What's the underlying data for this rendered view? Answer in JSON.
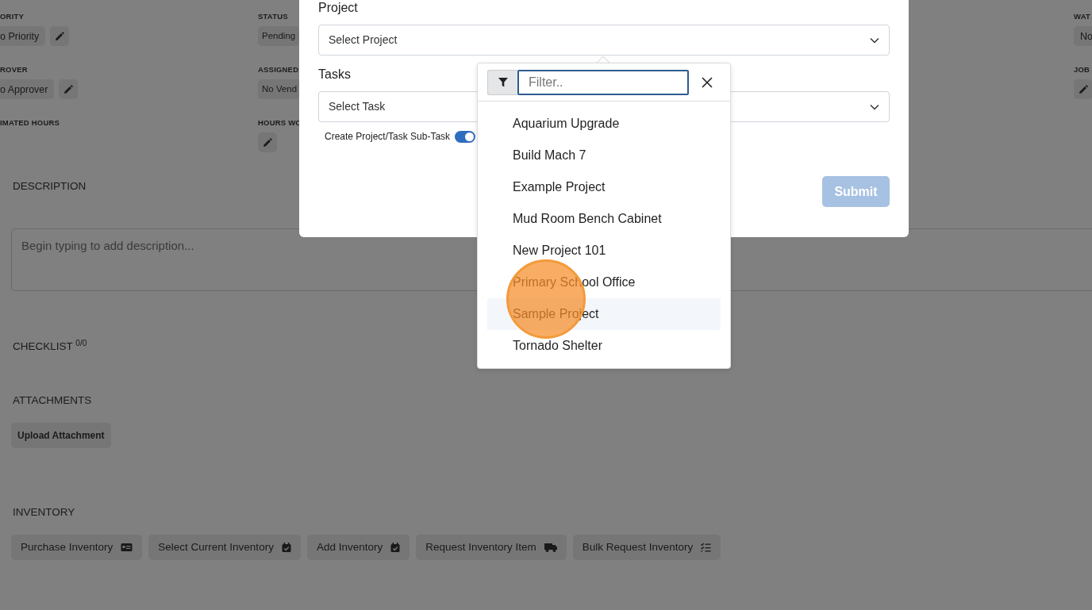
{
  "field_columns": [
    [
      {
        "label": "ORITY",
        "value": "o Priority",
        "kind": "value_edit"
      },
      {
        "label": "ROVER",
        "value": "o Approver",
        "kind": "value_edit"
      },
      {
        "label": "IMATED HOURS",
        "kind": "empty"
      }
    ],
    [
      {
        "label": "STATUS",
        "value": "Pending",
        "kind": "value"
      },
      {
        "label": "ASSIGNED",
        "value": "No Vend",
        "kind": "value"
      },
      {
        "label": "HOURS WO",
        "kind": "edit"
      }
    ],
    [
      {
        "label": "WAT",
        "value": "No",
        "kind": "value"
      },
      {
        "label": "JOB",
        "kind": "edit"
      }
    ]
  ],
  "description": {
    "heading": "DESCRIPTION",
    "placeholder": "Begin typing to add description..."
  },
  "checklist": {
    "heading": "CHECKLIST",
    "count": "0/0"
  },
  "attachments": {
    "heading": "ATTACHMENTS",
    "button": "Upload Attachment"
  },
  "inventory": {
    "heading": "INVENTORY",
    "buttons": [
      {
        "label": "Purchase Inventory",
        "kind": "card"
      },
      {
        "label": "Select Current Inventory",
        "kind": "calendar"
      },
      {
        "label": "Add Inventory",
        "kind": "calendar"
      },
      {
        "label": "Request Inventory Item",
        "kind": "truck"
      },
      {
        "label": "Bulk Request Inventory",
        "kind": "list"
      }
    ]
  },
  "modal": {
    "project_label": "Project",
    "project_placeholder": "Select Project",
    "tasks_label": "Tasks",
    "task_placeholder": "Select Task",
    "subtask_toggle": {
      "label": "Create Project/Task Sub-Task",
      "on": true
    },
    "submit": {
      "label": "Submit",
      "disabled": true
    }
  },
  "project_dropdown": {
    "filter_placeholder": "Filter..",
    "items": [
      {
        "label": "Aquarium Upgrade",
        "selected": false
      },
      {
        "label": "Build Mach 7",
        "selected": false
      },
      {
        "label": "Example Project",
        "selected": false
      },
      {
        "label": "Mud Room Bench Cabinet",
        "selected": false
      },
      {
        "label": "New Project 101",
        "selected": false
      },
      {
        "label": "Primary School Office",
        "selected": false
      },
      {
        "label": "Sample Project",
        "selected": true
      },
      {
        "label": "Tornado Shelter",
        "selected": false
      }
    ]
  }
}
